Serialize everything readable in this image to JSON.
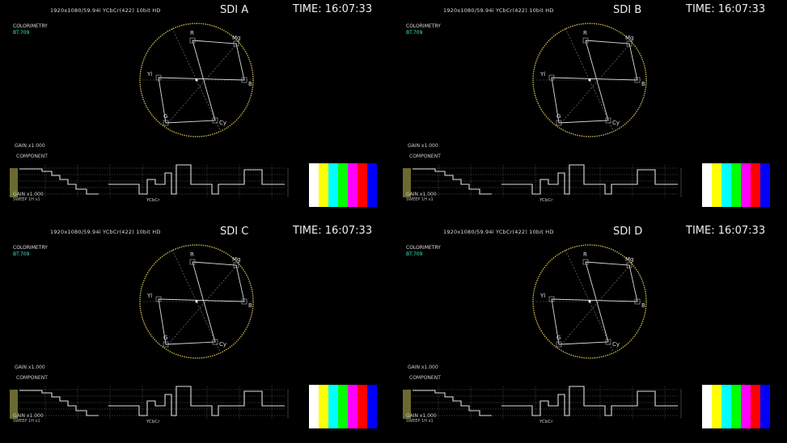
{
  "panels": [
    {
      "format": "1920x1080/59.94i  YCbCr(422) 10bit HD",
      "title": "SDI A",
      "time": "TIME: 16:07:33",
      "colorimetry_label": "COLORIMETRY",
      "colorimetry_value": "BT.709",
      "vector_gain": "GAIN x1.000",
      "component_label": "COMPONENT",
      "wfm_gain": "GAIN x1.000",
      "wfm_sweep": "SWEEP 1H x1",
      "ycbcr_label": "YCbCr"
    },
    {
      "format": "1920x1080/59.94i  YCbCr(422) 10bit HD",
      "title": "SDI B",
      "time": "TIME: 16:07:33",
      "colorimetry_label": "COLORIMETRY",
      "colorimetry_value": "BT.709",
      "vector_gain": "GAIN x1.000",
      "component_label": "COMPONENT",
      "wfm_gain": "GAIN x1.000",
      "wfm_sweep": "SWEEP 1H x1",
      "ycbcr_label": "YCbCr"
    },
    {
      "format": "1920x1080/59.94i  YCbCr(422) 10bit HD",
      "title": "SDI C",
      "time": "TIME: 16:07:33",
      "colorimetry_label": "COLORIMETRY",
      "colorimetry_value": "BT.709",
      "vector_gain": "GAIN x1.000",
      "component_label": "COMPONENT",
      "wfm_gain": "GAIN x1.000",
      "wfm_sweep": "SWEEP 1H x1",
      "ycbcr_label": "YCbCr"
    },
    {
      "format": "1920x1080/59.94i  YCbCr(422) 10bit HD",
      "title": "SDI D",
      "time": "TIME: 16:07:33",
      "colorimetry_label": "COLORIMETRY",
      "colorimetry_value": "BT.709",
      "vector_gain": "GAIN x1.000",
      "component_label": "COMPONENT",
      "wfm_gain": "GAIN x1.000",
      "wfm_sweep": "SWEEP 1H x1",
      "ycbcr_label": "YCbCr"
    }
  ],
  "vector_targets": [
    "R",
    "Mg",
    "B",
    "Cy",
    "G",
    "Yl"
  ],
  "colors": {
    "scale_circle": "#c8b44a",
    "trace": "#dcdcdc",
    "colorimetry_value": "#33eecc",
    "bars": [
      "#ffffff",
      "#ffff00",
      "#00ffff",
      "#00ff00",
      "#ff00ff",
      "#ff0000",
      "#0000ff"
    ]
  }
}
